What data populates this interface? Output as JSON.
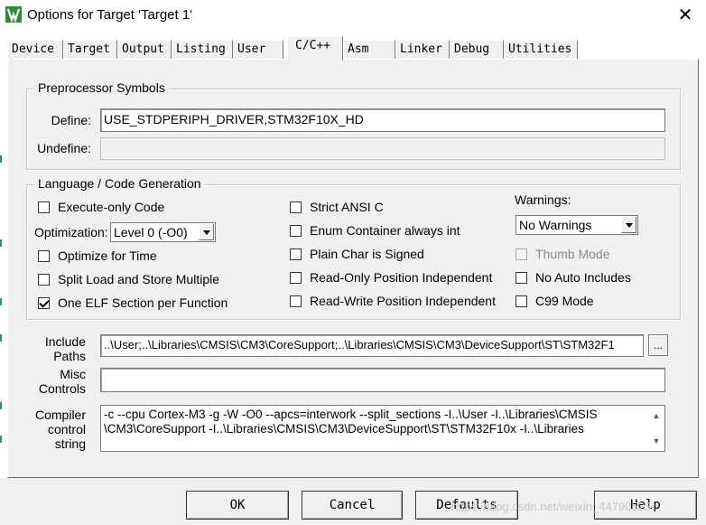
{
  "window": {
    "title": "Options for Target 'Target 1'",
    "icon": "keil-uvision-icon",
    "close_glyph": "✕"
  },
  "tabs": [
    {
      "label": "Device",
      "active": false
    },
    {
      "label": "Target",
      "active": false
    },
    {
      "label": "Output",
      "active": false
    },
    {
      "label": "Listing",
      "active": false
    },
    {
      "label": "User",
      "active": false
    },
    {
      "label": "C/C++",
      "active": true
    },
    {
      "label": "Asm",
      "active": false
    },
    {
      "label": "Linker",
      "active": false
    },
    {
      "label": "Debug",
      "active": false
    },
    {
      "label": "Utilities",
      "active": false
    }
  ],
  "preprocessor": {
    "legend": "Preprocessor Symbols",
    "define_label": "Define:",
    "define_value": "USE_STDPERIPH_DRIVER,STM32F10X_HD",
    "undefine_label": "Undefine:",
    "undefine_value": ""
  },
  "language": {
    "legend": "Language / Code Generation",
    "execute_only": {
      "label": "Execute-only Code",
      "checked": false
    },
    "optimization_label": "Optimization:",
    "optimization_value": "Level 0 (-O0)",
    "optimize_time": {
      "label": "Optimize for Time",
      "checked": false
    },
    "split_load": {
      "label": "Split Load and Store Multiple",
      "checked": false
    },
    "one_elf": {
      "label": "One ELF Section per Function",
      "checked": true
    },
    "strict_ansi": {
      "label": "Strict ANSI C",
      "checked": false
    },
    "enum_container": {
      "label": "Enum Container always int",
      "checked": false
    },
    "plain_char": {
      "label": "Plain Char is Signed",
      "checked": false
    },
    "ro_pi": {
      "label": "Read-Only Position Independent",
      "checked": false
    },
    "rw_pi": {
      "label": "Read-Write Position Independent",
      "checked": false
    },
    "warnings_label": "Warnings:",
    "warnings_value": "No Warnings",
    "thumb_mode": {
      "label": "Thumb Mode",
      "checked": false,
      "disabled": true
    },
    "no_auto_includes": {
      "label": "No Auto Includes",
      "checked": false
    },
    "c99_mode": {
      "label": "C99 Mode",
      "checked": false
    }
  },
  "paths": {
    "include_label": "Include\nPaths",
    "include_value": "..\\User;..\\Libraries\\CMSIS\\CM3\\CoreSupport;..\\Libraries\\CMSIS\\CM3\\DeviceSupport\\ST\\STM32F1",
    "browse_label": "...",
    "misc_label": "Misc\nControls",
    "misc_value": "",
    "compiler_label": "Compiler\ncontrol\nstring",
    "compiler_line1": "-c --cpu Cortex-M3 -g -W -O0 --apcs=interwork --split_sections -I..\\User -I..\\Libraries\\CMSIS",
    "compiler_line2": "\\CM3\\CoreSupport -I..\\Libraries\\CMSIS\\CM3\\DeviceSupport\\ST\\STM32F10x -I..\\Libraries"
  },
  "buttons": {
    "ok": "OK",
    "cancel": "Cancel",
    "defaults": "Defaults",
    "help": "Help"
  },
  "watermark": "https://blog.csdn.net/weixin_44790523"
}
